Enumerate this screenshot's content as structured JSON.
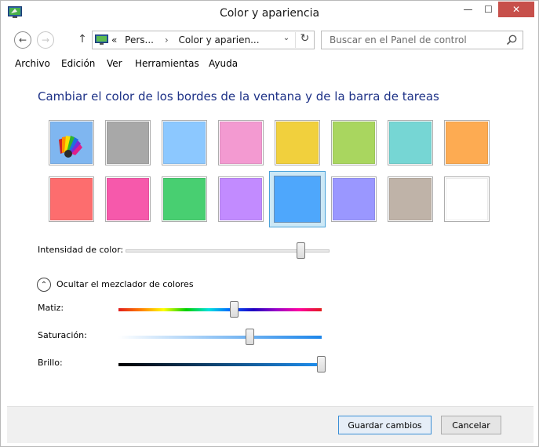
{
  "window": {
    "title": "Color y apariencia",
    "minimize_glyph": "—",
    "maximize_glyph": "☐",
    "close_glyph": "✕"
  },
  "nav": {
    "back_glyph": "←",
    "forward_glyph": "→",
    "up_glyph": "↑",
    "breadcrumb_prefix": "«",
    "breadcrumb_1": "Pers...",
    "breadcrumb_sep": "›",
    "breadcrumb_2": "Color y aparien...",
    "dropdown_glyph": "⌄",
    "refresh_glyph": "↻",
    "search_placeholder": "Buscar en el Panel de control"
  },
  "menu": {
    "items": [
      "Archivo",
      "Edición",
      "Ver",
      "Herramientas",
      "Ayuda"
    ]
  },
  "content": {
    "heading": "Cambiar el color de los bordes de la ventana y de la barra de tareas",
    "swatches_row1": [
      "custom-palette",
      "#a8a8a8",
      "#8cc8ff",
      "#f39ad1",
      "#f1d03d",
      "#a9d65f",
      "#76d6d4",
      "#fdab52"
    ],
    "swatches_row2": [
      "#fd6d6e",
      "#f659ab",
      "#48cf71",
      "#c28bff",
      "#4ea7fc",
      "#9a97ff",
      "#bfb3a8",
      "#ffffff"
    ],
    "selected_swatch": "#4ea7fc",
    "intensity_label": "Intensidad de color:",
    "intensity_value": 0.86,
    "mixer_toggle_glyph": "⌃",
    "mixer_toggle_label": "Ocultar el mezclador de colores",
    "hue_label": "Matiz:",
    "hue_value": 0.57,
    "saturation_label": "Saturación:",
    "saturation_value": 0.65,
    "brightness_label": "Brillo:",
    "brightness_value": 1.0
  },
  "footer": {
    "save_label": "Guardar cambios",
    "cancel_label": "Cancelar"
  }
}
